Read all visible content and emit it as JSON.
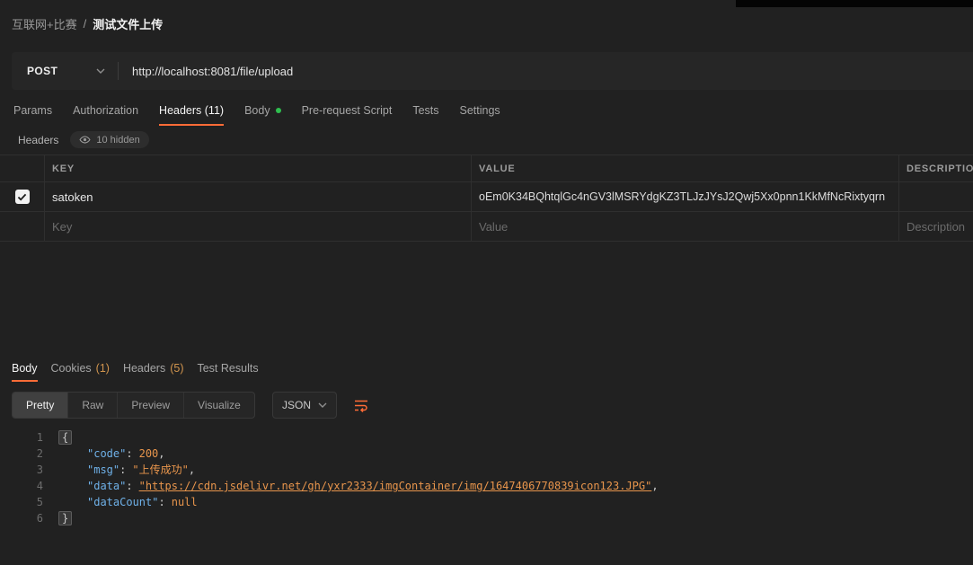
{
  "colors": {
    "accent": "#ff6c37",
    "background": "#212121"
  },
  "breadcrumb": {
    "workspace": "互联网+比赛",
    "separator": "/",
    "request": "测试文件上传"
  },
  "request_bar": {
    "method": "POST",
    "url": "http://localhost:8081/file/upload"
  },
  "request_tabs": {
    "params": "Params",
    "authorization": "Authorization",
    "headers": "Headers (11)",
    "body": "Body",
    "prerequest": "Pre-request Script",
    "tests": "Tests",
    "settings": "Settings"
  },
  "headers_editor": {
    "title": "Headers",
    "hidden_label": "10 hidden",
    "columns": {
      "key": "KEY",
      "value": "VALUE",
      "description": "DESCRIPTION"
    },
    "row1": {
      "key": "satoken",
      "value": "oEm0K34BQhtqlGc4nGV3lMSRYdgKZ3TLJzJYsJ2Qwj5Xx0pnn1KkMfNcRixtyqrn"
    },
    "placeholders": {
      "key": "Key",
      "value": "Value",
      "description": "Description"
    }
  },
  "response": {
    "tab_body": "Body",
    "tab_cookies": "Cookies",
    "tab_cookies_count": "(1)",
    "tab_headers": "Headers",
    "tab_headers_count": "(5)",
    "tab_tests": "Test Results",
    "view_pretty": "Pretty",
    "view_raw": "Raw",
    "view_preview": "Preview",
    "view_visualize": "Visualize",
    "format": "JSON"
  },
  "code": {
    "line_numbers": [
      "1",
      "2",
      "3",
      "4",
      "5",
      "6"
    ],
    "open_brace": "{",
    "close_brace": "}",
    "colon": ":",
    "comma": ",",
    "lines": {
      "code": {
        "key": "\"code\"",
        "value": "200"
      },
      "msg": {
        "key": "\"msg\"",
        "value": "\"上传成功\""
      },
      "data": {
        "key": "\"data\"",
        "value": "\"https://cdn.jsdelivr.net/gh/yxr2333/imgContainer/img/1647406770839icon123.JPG\""
      },
      "dataCount": {
        "key": "\"dataCount\"",
        "value": "null"
      }
    }
  }
}
